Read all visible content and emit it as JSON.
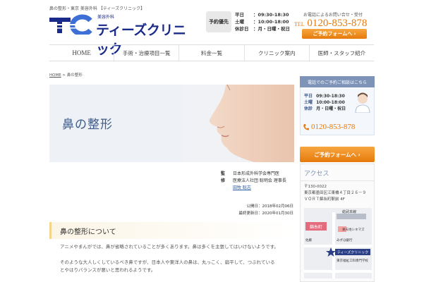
{
  "header": {
    "topline": "鼻の整形・東京 美容外科 【ティーズクリニック】",
    "logo_sub": "美容外科",
    "logo_name": "ティーズクリニック",
    "reserve_badge": "予約優先",
    "hours": [
      {
        "day": "平日",
        "time": "：09:30-18:30"
      },
      {
        "day": "土曜",
        "time": "：10:00-18:00"
      },
      {
        "day": "休診日",
        "time": "：月・日曜・祝日"
      }
    ],
    "tel_lead": "お電話によるお問い合せ・受付",
    "tel_label": "TEL",
    "tel": "0120-853-878",
    "form_button": "ご予約フォームへ"
  },
  "nav": [
    "HOME",
    "手術・治療項目一覧",
    "料金一覧",
    "クリニック案内",
    "医師・スタッフ紹介"
  ],
  "breadcrumb": {
    "home": "HOME",
    "sep": " > ",
    "current": "鼻の整形"
  },
  "hero": {
    "title": "鼻の整形"
  },
  "supervisor": {
    "label": "監修",
    "lines": [
      "日本形成外科学会専門医",
      "医療法人社団 聡明会 理事長"
    ],
    "name": "田牧 聡志"
  },
  "dates": {
    "published": "公開日：2018年02月06日",
    "updated": "最終更新日：2020年01月30日"
  },
  "section": {
    "heading": "鼻の整形について"
  },
  "paragraphs": [
    "アニメやまんがでは、鼻が省略されていることが多くあります。鼻は多くを主張してはいけないようです。",
    "そのような大人しくしているべき鼻ですが、日本人や東洋人の鼻は、丸っこく、扁平して、つぶれている",
    "とやはりバランスが悪いと思われるようです。"
  ],
  "sidebar": {
    "head": "電話でのご予約ご相談はこちら",
    "hours": [
      {
        "day": "平日",
        "time": "09:30-18:30"
      },
      {
        "day": "土曜",
        "time": "10:00-18:00"
      },
      {
        "day": "休診",
        "time": "月・日曜・祝日"
      }
    ],
    "tel": "0120-853-878",
    "form_button": "ご予約フォームへ"
  },
  "access": {
    "title": "アクセス",
    "address": [
      "〒130-0022",
      "東京都墨田区江東橋４丁目２６－９",
      "ＶＯＲＴ錦糸町駅前 4F"
    ],
    "map_labels": {
      "station": "錦糸町",
      "line": "総武本線",
      "cinema": "楽天地シネマズ",
      "bank": "みずほ銀行",
      "clinic": "ティーズクリニック",
      "school": "東京福祉工科専門学校",
      "sato": "佐藤"
    }
  },
  "colors": {
    "accent": "#e67a0a",
    "brand": "#1a2a8a",
    "side_blue": "#7d93b7"
  }
}
